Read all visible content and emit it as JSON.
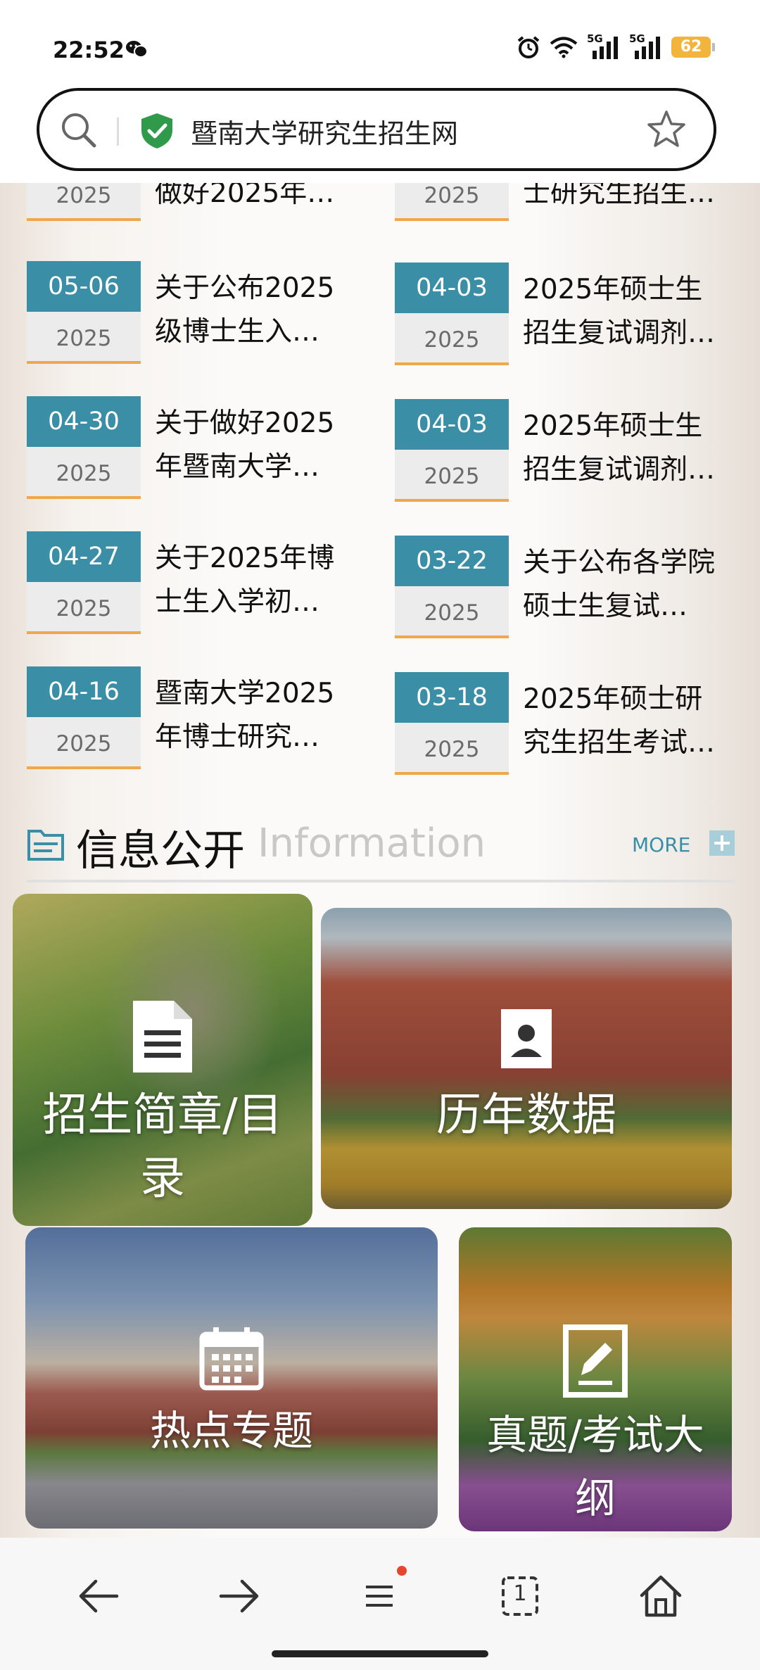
{
  "status_bar": {
    "time": "22:52",
    "battery": "62",
    "network_1": "5G",
    "network_2": "5G",
    "icons": [
      "wechat-icon",
      "alarm-icon",
      "wifi-icon",
      "signal-icon",
      "signal-icon",
      "battery-icon"
    ]
  },
  "address_bar": {
    "url_text": "暨南大学研究生招生网",
    "icons": [
      "search-icon",
      "shield-check-icon",
      "star-icon"
    ],
    "colors": {
      "shield": "#2e9a4a"
    }
  },
  "news": {
    "left": [
      {
        "md": "",
        "year": "2025",
        "title": "做好2025年…"
      },
      {
        "md": "05-06",
        "year": "2025",
        "title": "关于公布2025级博士生入…"
      },
      {
        "md": "04-30",
        "year": "2025",
        "title": "关于做好2025年暨南大学…"
      },
      {
        "md": "04-27",
        "year": "2025",
        "title": "关于2025年博士生入学初…"
      },
      {
        "md": "04-16",
        "year": "2025",
        "title": "暨南大学2025年博士研究…"
      }
    ],
    "right": [
      {
        "md": "",
        "year": "2025",
        "title": "士研究生招生…"
      },
      {
        "md": "04-03",
        "year": "2025",
        "title": "2025年硕士生招生复试调剂…"
      },
      {
        "md": "04-03",
        "year": "2025",
        "title": "2025年硕士生招生复试调剂…"
      },
      {
        "md": "03-22",
        "year": "2025",
        "title": "关于公布各学院硕士生复试…"
      },
      {
        "md": "03-18",
        "year": "2025",
        "title": "2025年硕士研究生招生考试…"
      }
    ],
    "colors": {
      "date_top": "#3a8fa7",
      "date_bottom_line": "#f0a64a"
    }
  },
  "section": {
    "title_cn": "信息公开",
    "title_en": "Information",
    "more_label": "MORE"
  },
  "tiles": [
    {
      "label": "招生简章/目录",
      "icon": "document-icon"
    },
    {
      "label": "历年数据",
      "icon": "contact-card-icon"
    },
    {
      "label": "热点专题",
      "icon": "calendar-icon"
    },
    {
      "label": "真题/考试大纲",
      "icon": "edit-icon"
    }
  ],
  "bottom_nav": {
    "tab_count": "1",
    "icons": [
      "back-icon",
      "forward-icon",
      "menu-icon",
      "tabs-icon",
      "home-icon"
    ]
  }
}
